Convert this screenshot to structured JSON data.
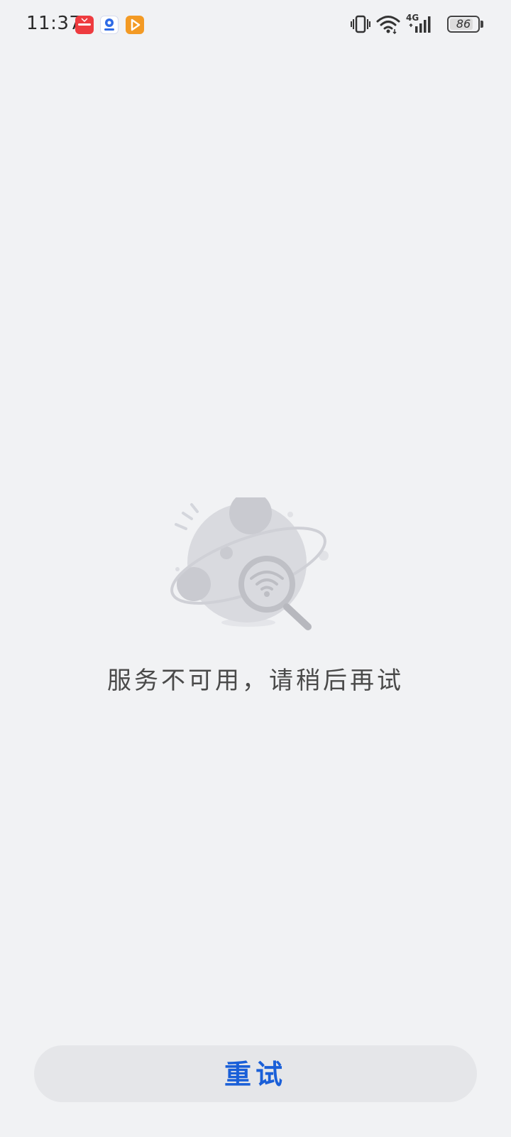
{
  "status_bar": {
    "time": "11:37",
    "network": "4G",
    "battery": "86",
    "battery_level": 0.86,
    "app_icons": [
      "shopping-app-icon",
      "baidu-map-app-icon",
      "video-app-icon"
    ]
  },
  "empty_state": {
    "message": "服务不可用，请稍后再试",
    "illustration": "planet-search-wifi-icon"
  },
  "actions": {
    "retry_label": "重试"
  },
  "colors": {
    "background": "#f1f2f4",
    "accent": "#1a5fd8",
    "button_bg": "#e5e6e9",
    "illustration_gray": "#d9dadf"
  }
}
